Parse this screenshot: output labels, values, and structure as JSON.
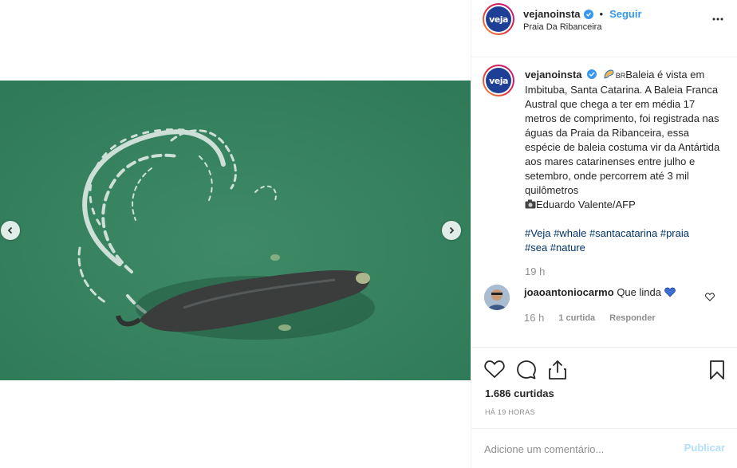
{
  "post": {
    "username": "vejanoinsta",
    "follow_label": "Seguir",
    "location": "Praia Da Ribanceira",
    "avatar_text": "veja"
  },
  "caption": {
    "username": "vejanoinsta",
    "flag_text": "BR",
    "text": "Baleia é vista em Imbituba, Santa Catarina. A Baleia Franca Austral que chega a ter em média 17 metros de comprimento, foi registrada nas águas da Praia da Ribanceira, essa espécie de baleia costuma vir da Antártida aos mares catarinenses entre julho e setembro, onde percorrem até 3 mil quilômetros",
    "credit": "Eduardo Valente/AFP",
    "hashtags_line1": "#Veja #whale #santacatarina #praia",
    "hashtags_line2": "#sea #nature",
    "time": "19 h"
  },
  "comment": {
    "username": "joaoantoniocarmo",
    "text": "Que linda",
    "time": "16 h",
    "likes": "1 curtida",
    "reply_label": "Responder"
  },
  "stats": {
    "likes": "1.686 curtidas",
    "posted": "HÁ 19 HORAS"
  },
  "composer": {
    "placeholder": "Adicione um comentário...",
    "publish_label": "Publicar"
  },
  "colors": {
    "link": "#3897f0",
    "hashtag": "#003569",
    "sea": "#3f8f6c",
    "brand": "#1e3f96"
  }
}
